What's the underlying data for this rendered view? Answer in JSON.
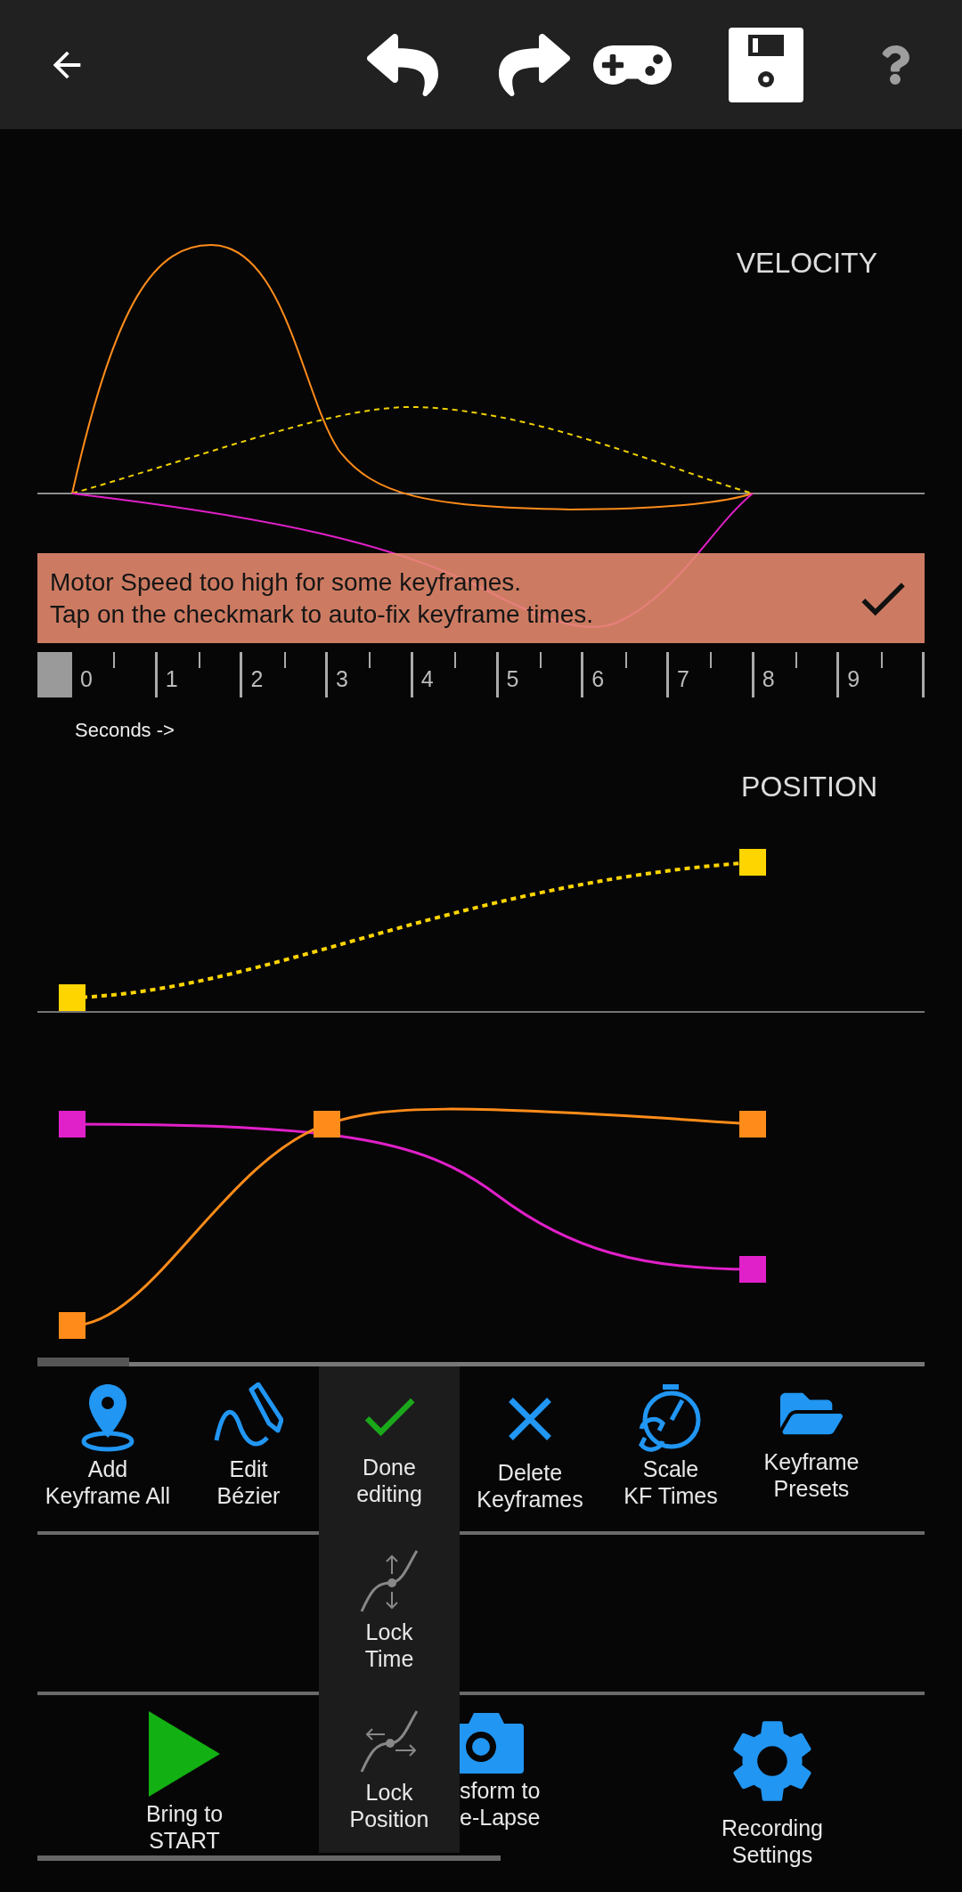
{
  "top_bar": {
    "buttons": [
      {
        "kind": "back",
        "disabled": false
      },
      {
        "kind": "undo",
        "disabled": false
      },
      {
        "kind": "redo",
        "disabled": false
      },
      {
        "kind": "gamepad",
        "disabled": false
      },
      {
        "kind": "save",
        "disabled": false
      },
      {
        "kind": "help",
        "disabled": true
      }
    ]
  },
  "velocity": {
    "title": "VELOCITY"
  },
  "warning": {
    "text": "Motor Speed too high for some keyframes.\nTap on the checkmark to auto-fix keyframe times."
  },
  "ruler": {
    "ticks": [
      "0",
      "1",
      "2",
      "3",
      "4",
      "5",
      "6",
      "7",
      "8",
      "9"
    ],
    "unit_label": "Seconds ->"
  },
  "position": {
    "title": "POSITION"
  },
  "toolbar": {
    "row_1": [
      {
        "kind": "location",
        "label": "Add\nKeyframe All"
      },
      {
        "kind": "bezier",
        "label": "Edit\nBézier"
      },
      {
        "kind": "gap"
      },
      {
        "kind": "close",
        "label": "Delete\nKeyframes"
      },
      {
        "kind": "timer",
        "label": "Scale\nKF Times"
      },
      {
        "kind": "folder",
        "label": "Keyframe\nPresets"
      }
    ],
    "row_3": [
      {
        "kind": "play",
        "label": "Bring to\nSTART"
      },
      {
        "kind": "camera",
        "label": "sform to\ne-Lapse"
      },
      {
        "kind": "gear",
        "label": "Recording\nSettings"
      }
    ]
  },
  "edit_menu": {
    "items": [
      {
        "kind": "check",
        "label": "Done\nediting"
      },
      {
        "kind": "lock_time",
        "label": "Lock\nTime"
      },
      {
        "kind": "lock_position",
        "label": "Lock\nPosition"
      }
    ]
  }
}
